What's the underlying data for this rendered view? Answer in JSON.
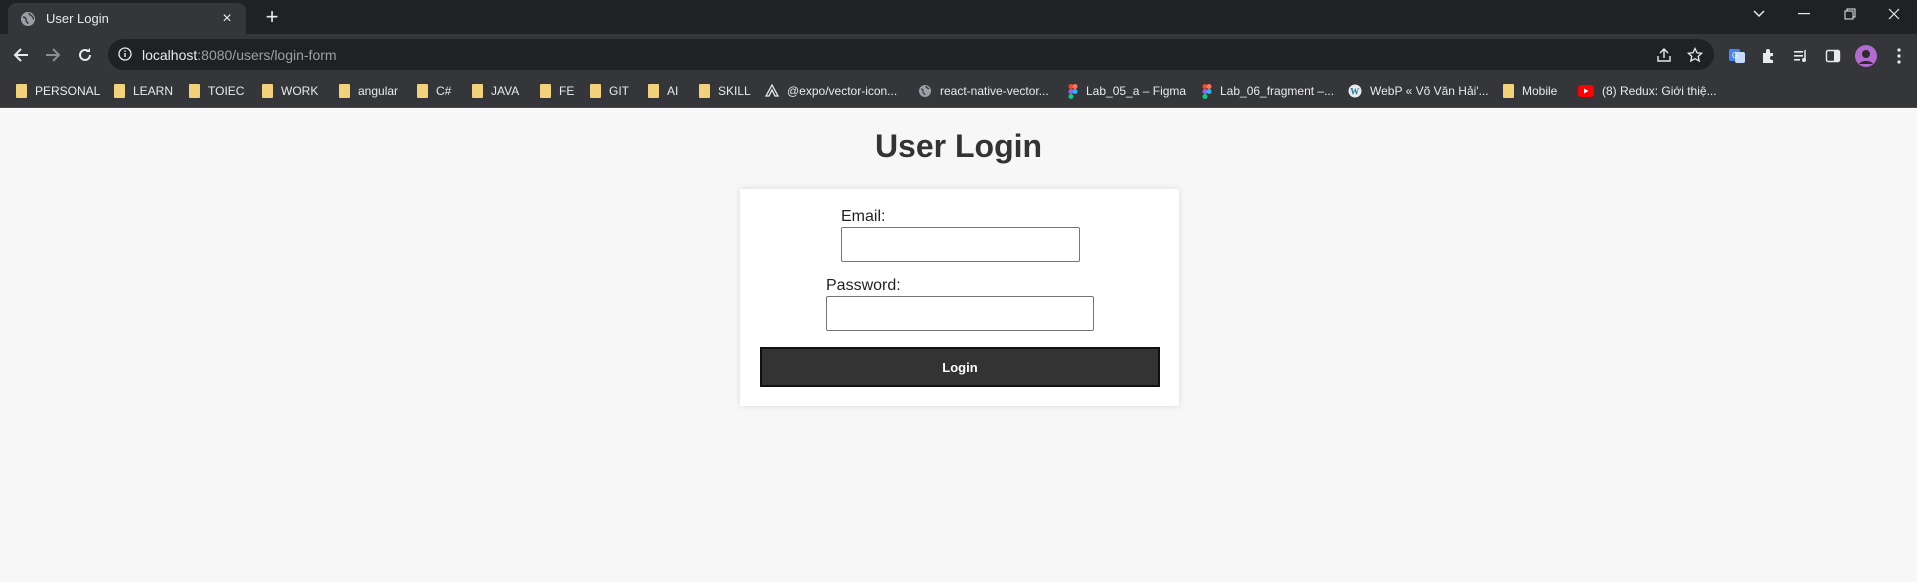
{
  "browser": {
    "tab": {
      "title": "User Login",
      "close": "×"
    },
    "new_tab": "+",
    "url": {
      "host": "localhost",
      "path": ":8080/users/login-form"
    },
    "bookmarks": [
      {
        "label": "PERSONAL",
        "icon": "folder-icon"
      },
      {
        "label": "LEARN",
        "icon": "folder-icon"
      },
      {
        "label": "TOIEC",
        "icon": "folder-icon"
      },
      {
        "label": "WORK",
        "icon": "folder-icon"
      },
      {
        "label": "angular",
        "icon": "folder-icon"
      },
      {
        "label": "C#",
        "icon": "folder-icon"
      },
      {
        "label": "JAVA",
        "icon": "folder-icon"
      },
      {
        "label": "FE",
        "icon": "folder-icon"
      },
      {
        "label": "GIT",
        "icon": "folder-icon"
      },
      {
        "label": "AI",
        "icon": "folder-icon"
      },
      {
        "label": "SKILL",
        "icon": "folder-icon"
      },
      {
        "label": "@expo/vector-icon...",
        "icon": "expo-icon"
      },
      {
        "label": "react-native-vector...",
        "icon": "globe-icon"
      },
      {
        "label": "Lab_05_a – Figma",
        "icon": "figma-icon"
      },
      {
        "label": "Lab_06_fragment –...",
        "icon": "figma-icon"
      },
      {
        "label": "WebP « Võ Văn Hải'...",
        "icon": "wordpress-icon"
      },
      {
        "label": "Mobile",
        "icon": "folder-icon"
      },
      {
        "label": "(8) Redux: Giới thiệ...",
        "icon": "youtube-icon"
      }
    ]
  },
  "page": {
    "title": "User Login",
    "email_label": "Email:",
    "email_value": "",
    "password_label": "Password:",
    "password_value": "",
    "login_button": "Login"
  },
  "colors": {
    "chrome_dark": "#202124",
    "chrome_toolbar": "#35363a",
    "page_bg": "#f7f7f7",
    "button_bg": "#333333",
    "folder": "#f2d27a"
  }
}
